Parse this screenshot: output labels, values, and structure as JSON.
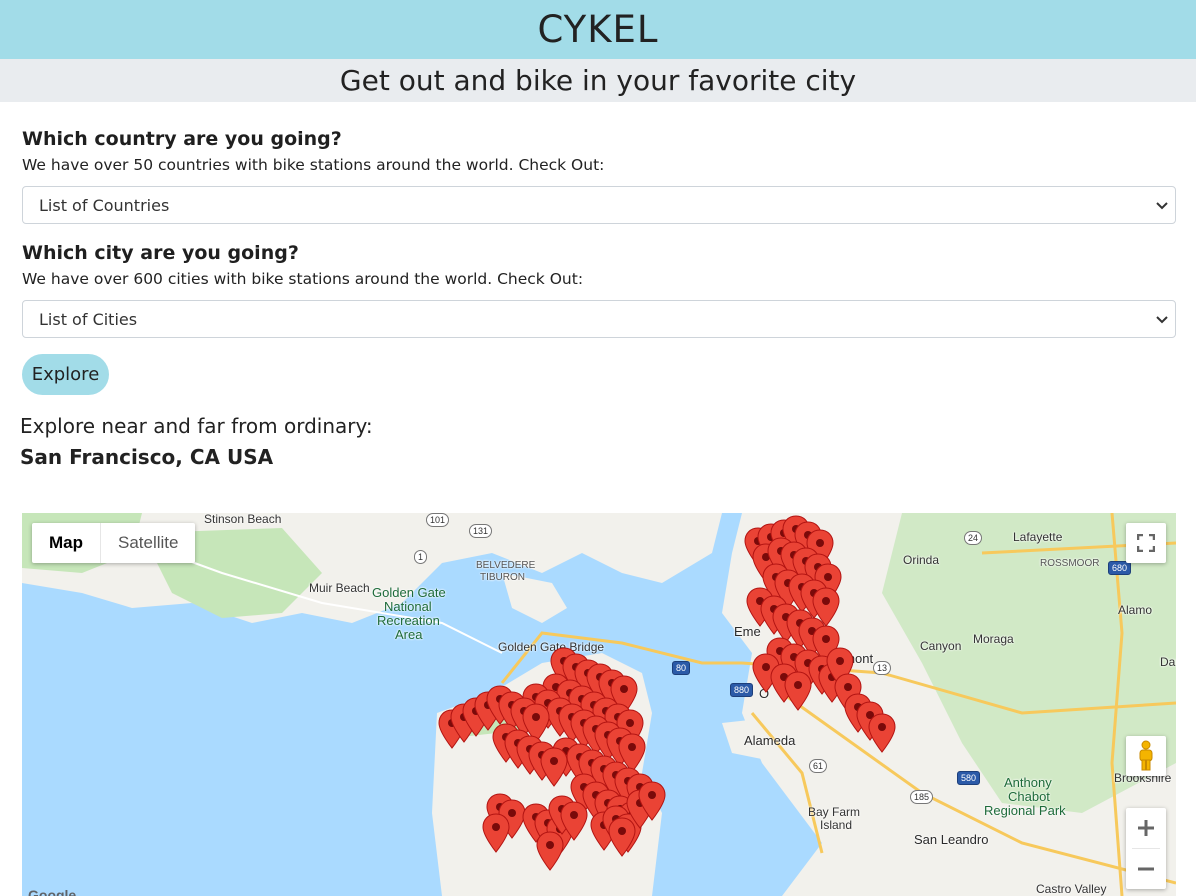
{
  "header": {
    "brand": "CYKEL",
    "tagline": "Get out and bike in your favorite city"
  },
  "country": {
    "question": "Which country are you going?",
    "subtitle": "We have over 50 countries with bike stations around the world. Check Out:",
    "selected": "List of Countries"
  },
  "city": {
    "question": "Which city are you going?",
    "subtitle": "We have over 600 cities with bike stations around the world. Check Out:",
    "selected": "List of Cities"
  },
  "explore_button": "Explore",
  "explore": {
    "label": "Explore near and far from ordinary:",
    "location": "San Francisco, CA USA"
  },
  "map": {
    "type_options": [
      "Map",
      "Satellite"
    ],
    "selected_type": "Map",
    "labels": {
      "stinson_beach": "Stinson Beach",
      "belvedere": "BELVEDERE",
      "tiburon": "TIBURON",
      "muir_beach": "Muir Beach",
      "ggnra_1": "Golden Gate",
      "ggnra_2": "National",
      "ggnra_3": "Recreation",
      "ggnra_4": "Area",
      "golden_gate_bridge": "Golden Gate Bridge",
      "alameda": "Alameda",
      "bay_farm_1": "Bay Farm",
      "bay_farm_2": "Island",
      "san_leandro": "San Leandro",
      "orinda": "Orinda",
      "lafayette": "Lafayette",
      "rossmoor": "ROSSMOOR",
      "alamo": "Alamo",
      "moraga": "Moraga",
      "canyon": "Canyon",
      "anthony_1": "Anthony",
      "anthony_2": "Chabot",
      "anthony_3": "Regional Park",
      "brookshire": "Brookshire",
      "castro_valley": "Castro Valley",
      "dan": "Dan",
      "emeryville": "Eme",
      "piedmont": "dmont",
      "oakland": "O",
      "google": "Google"
    },
    "route_shields": [
      "101",
      "131",
      "1",
      "24",
      "80",
      "13",
      "880",
      "61",
      "580",
      "185",
      "680"
    ],
    "colors": {
      "water": "#aadaff",
      "land": "#f2f1ec",
      "park": "#c6e6b9",
      "marker": "#ea4335"
    },
    "controls": [
      "fullscreen-icon",
      "pegman-icon",
      "zoom-in",
      "zoom-out"
    ]
  }
}
